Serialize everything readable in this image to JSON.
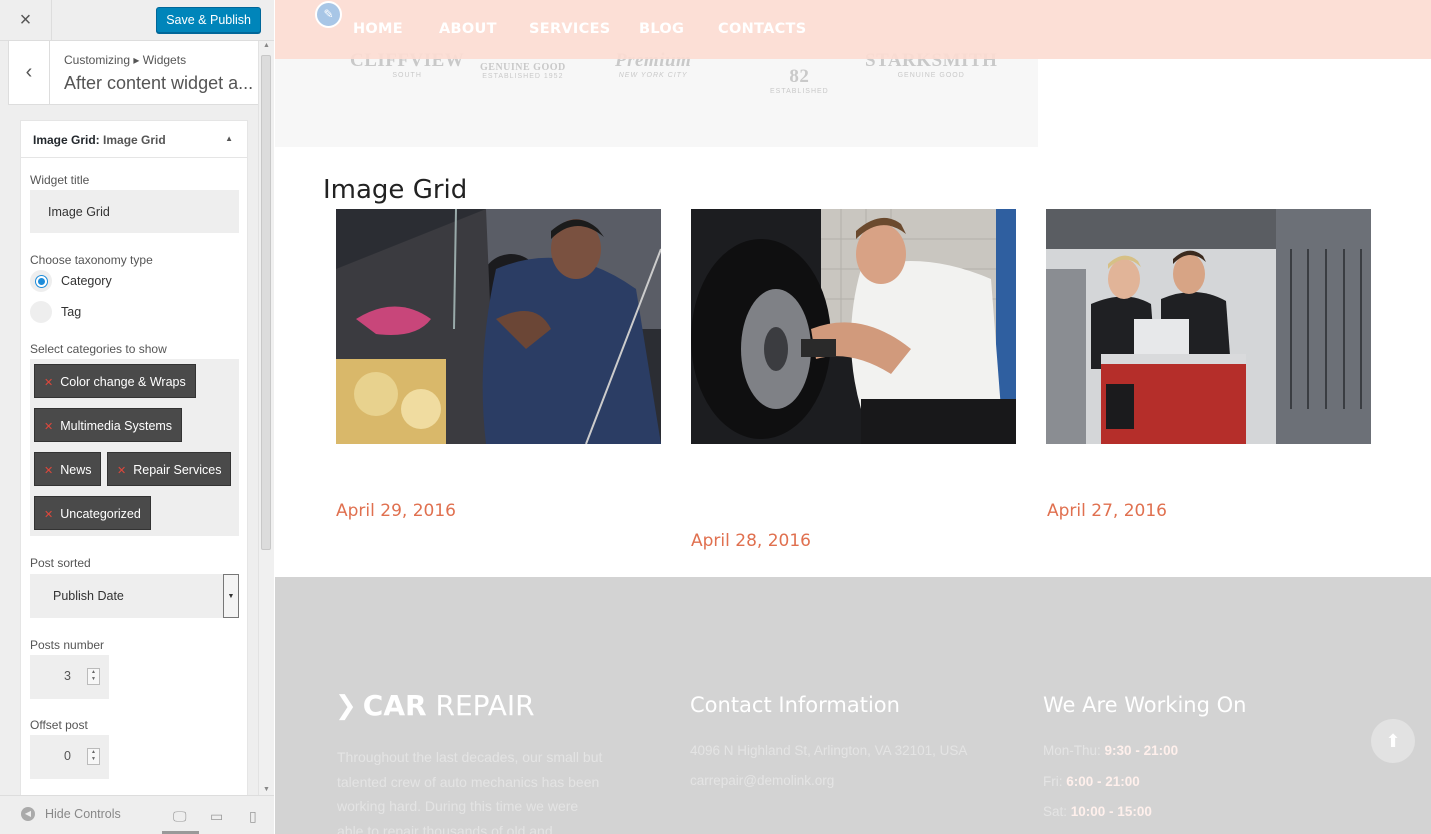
{
  "sidebar": {
    "close_icon": "×",
    "publish_label": "Save & Publish",
    "breadcrumb": "Customizing ▸ Widgets",
    "section_title": "After content widget a...",
    "widget": {
      "title_type": "Image Grid:",
      "title_name": "Image Grid",
      "fields": {
        "widget_title_label": "Widget title",
        "widget_title_value": "Image Grid",
        "taxonomy_label": "Choose taxonomy type",
        "taxonomy_options": [
          "Category",
          "Tag"
        ],
        "taxonomy_selected": "Category",
        "categories_label": "Select categories to show",
        "categories": [
          "Color change & Wraps",
          "Multimedia Systems",
          "News",
          "Repair Services",
          "Uncategorized"
        ],
        "sorted_label": "Post sorted",
        "sorted_value": "Publish Date",
        "posts_number_label": "Posts number",
        "posts_number_value": "3",
        "offset_label": "Offset post",
        "offset_value": "0"
      }
    },
    "footer": {
      "hide_controls": "Hide Controls"
    }
  },
  "preview": {
    "nav": [
      "HOME",
      "ABOUT",
      "SERVICES",
      "BLOG",
      "CONTACTS"
    ],
    "logos": [
      {
        "name": "CLIFFVIEW",
        "sub": "SOUTH"
      },
      {
        "name": "GENUINE GOOD",
        "sub": "ESTABLISHED 1952"
      },
      {
        "name": "Premium",
        "sub": "NEW YORK CITY"
      },
      {
        "name": "82",
        "sub": "ESTABLISHED"
      },
      {
        "name": "STARKSMITH",
        "sub": "GENUINE GOOD"
      }
    ],
    "grid": {
      "title": "Image Grid",
      "dates": [
        "April 29, 2016",
        "April 28, 2016",
        "April 27, 2016"
      ]
    },
    "footer": {
      "logo_bold": "CAR",
      "logo_light": "REPAIR",
      "about": "Throughout the last decades, our small but talented crew of auto mechanics has been working hard. During this time we were able to repair thousands of old and",
      "contact_heading": "Contact Information",
      "contact_address": "4096 N Highland St, Arlington, VA 32101, USA",
      "contact_email": "carrepair@demolink.org",
      "hours_heading": "We Are Working On",
      "hours": [
        {
          "day": "Mon-Thu:",
          "time": "9:30 - 21:00"
        },
        {
          "day": "Fri:",
          "time": "6:00 - 21:00"
        },
        {
          "day": "Sat:",
          "time": "10:00 - 15:00"
        }
      ]
    }
  },
  "colors": {
    "accent": "#0085ba",
    "date": "#e0704f",
    "nav_bg": "#fcdcd2",
    "chip_bg": "#4a4a4a"
  }
}
